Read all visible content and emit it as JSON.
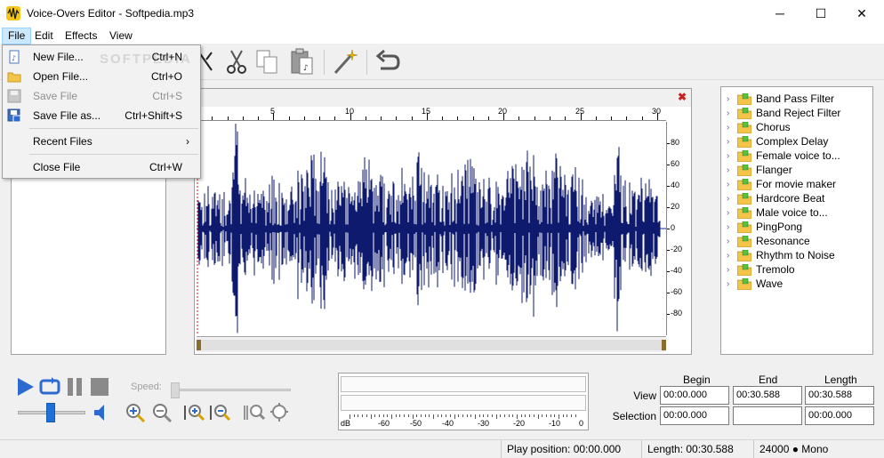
{
  "window": {
    "title": "Voice-Overs Editor - Softpedia.mp3",
    "minimize": "─",
    "maximize": "☐",
    "close": "✕"
  },
  "menubar": {
    "file": "File",
    "edit": "Edit",
    "effects": "Effects",
    "view": "View"
  },
  "file_menu": {
    "new_file": {
      "label": "New File...",
      "shortcut": "Ctrl+N"
    },
    "open_file": {
      "label": "Open File...",
      "shortcut": "Ctrl+O"
    },
    "save_file": {
      "label": "Save File",
      "shortcut": "Ctrl+S"
    },
    "save_file_as": {
      "label": "Save File as...",
      "shortcut": "Ctrl+Shift+S"
    },
    "recent_files": {
      "label": "Recent Files",
      "arrow": "›"
    },
    "close_file": {
      "label": "Close File",
      "shortcut": "Ctrl+W"
    }
  },
  "watermark": "SOFTPEDIA",
  "waveform": {
    "close": "✖",
    "ruler_ticks": [
      "5",
      "10",
      "15",
      "20",
      "25",
      "30"
    ],
    "y_ticks": [
      "80",
      "60",
      "40",
      "20",
      "0",
      "-20",
      "-40",
      "-60",
      "-80"
    ],
    "wave_color": "#0d1a6e"
  },
  "effects": [
    "Band Pass Filter",
    "Band Reject Filter",
    "Chorus",
    "Complex Delay",
    "Female voice to...",
    "Flanger",
    "For movie maker",
    "Hardcore Beat",
    "Male voice to...",
    "PingPong",
    "Resonance",
    "Rhythm to Noise",
    "Tremolo",
    "Wave"
  ],
  "playback": {
    "speed_label": "Speed:"
  },
  "meter": {
    "scale": [
      "dB",
      "-60",
      "-50",
      "-40",
      "-30",
      "-20",
      "-10",
      "0"
    ]
  },
  "info": {
    "begin_header": "Begin",
    "end_header": "End",
    "length_header": "Length",
    "view_label": "View",
    "selection_label": "Selection",
    "view_begin": "00:00.000",
    "view_end": "00:30.588",
    "view_length": "00:30.588",
    "sel_begin": "00:00.000",
    "sel_end": "",
    "sel_length": "00:00.000"
  },
  "status": {
    "play_position": "Play position: 00:00.000",
    "length": "Length: 00:30.588",
    "format": "24000 ● Mono"
  }
}
